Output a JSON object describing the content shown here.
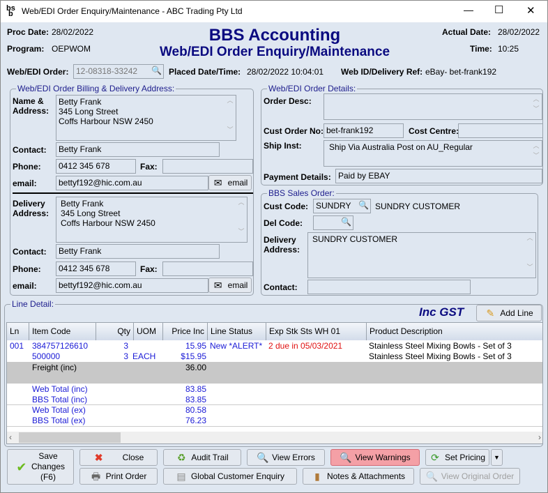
{
  "window": {
    "title": "Web/EDI Order Enquiry/Maintenance - ABC Trading Pty Ltd",
    "minimize": "—",
    "maximize": "☐",
    "close": "✕"
  },
  "header": {
    "proc_date_label": "Proc Date:",
    "proc_date": "28/02/2022",
    "program_label": "Program:",
    "program": "OEPWOM",
    "app_title": "BBS Accounting",
    "screen_title": "Web/EDI Order Enquiry/Maintenance",
    "actual_date_label": "Actual Date:",
    "actual_date": "28/02/2022",
    "time_label": "Time:",
    "time": "10:25"
  },
  "order": {
    "label": "Web/EDI Order:",
    "value": "12-08318-33242",
    "placed_label": "Placed Date/Time:",
    "placed": "28/02/2022 10:04:01",
    "webid_label": "Web ID/Delivery Ref:",
    "webid": "eBay- bet-frank192"
  },
  "billing": {
    "group_title": "Web/EDI Order Billing & Delivery Address:",
    "name_label": "Name &\nAddress:",
    "name_address": "Betty Frank\n345 Long Street\nCoffs Harbour NSW 2450",
    "contact_label": "Contact:",
    "contact": "Betty Frank",
    "phone_label": "Phone:",
    "phone": "0412 345 678",
    "fax_label": "Fax:",
    "fax": "",
    "email_label": "email:",
    "email": "bettyf192@hic.com.au",
    "email_button": "email"
  },
  "delivery": {
    "address_label": "Delivery\nAddress:",
    "address": "Betty Frank\n345 Long Street\nCoffs Harbour NSW 2450",
    "contact_label": "Contact:",
    "contact": "Betty Frank",
    "phone_label": "Phone:",
    "phone": "0412 345 678",
    "fax_label": "Fax:",
    "fax": "",
    "email_label": "email:",
    "email": "bettyf192@hic.com.au",
    "email_button": "email"
  },
  "details": {
    "group_title": "Web/EDI Order Details:",
    "desc_label": "Order Desc:",
    "desc": "",
    "cust_order_label": "Cust Order No:",
    "cust_order": "bet-frank192",
    "cost_centre_label": "Cost Centre:",
    "cost_centre": "",
    "ship_label": "Ship Inst:",
    "ship": "Ship Via Australia Post on AU_Regular",
    "payment_label": "Payment Details:",
    "payment": "Paid by EBAY"
  },
  "sales_order": {
    "group_title": "BBS Sales Order:",
    "cust_code_label": "Cust Code:",
    "cust_code": "SUNDRY",
    "cust_name": "SUNDRY CUSTOMER",
    "del_code_label": "Del Code:",
    "del_code": "",
    "del_addr_label": "Delivery\nAddress:",
    "del_addr": "SUNDRY CUSTOMER",
    "contact_label": "Contact:",
    "contact": ""
  },
  "lines": {
    "group_title": "Line Detail:",
    "inc_gst": "Inc GST",
    "add_line": "Add Line",
    "columns": [
      "Ln",
      "Item Code",
      "Qty",
      "UOM",
      "Price Inc",
      "Line Status",
      "Exp Stk Sts WH 01",
      "Product Description"
    ],
    "rows": [
      {
        "ln": "001",
        "item": "384757126610",
        "qty": "3",
        "uom": "",
        "price": "15.95",
        "status": "New *ALERT*",
        "stock": "2 due in 05/03/2021",
        "desc": "Stainless Steel Mixing Bowls - Set of 3"
      },
      {
        "ln": "",
        "item": "500000",
        "qty": "3",
        "uom": "EACH",
        "price": "$15.95",
        "status": "",
        "stock": "",
        "desc": "Stainless Steel Mixing Bowls - Set of 3"
      }
    ],
    "freight_label": "Freight (inc)",
    "freight": "36.00",
    "totals": [
      {
        "label": "Web Total (inc)",
        "value": "83.85"
      },
      {
        "label": "BBS Total (inc)",
        "value": "83.85"
      },
      {
        "label": "Web Total (ex)",
        "value": "80.58"
      },
      {
        "label": "BBS Total (ex)",
        "value": "76.23"
      }
    ]
  },
  "buttons": {
    "save": "Save\nChanges\n(F6)",
    "close": "Close",
    "audit": "Audit Trail",
    "errors": "View Errors",
    "warnings": "View Warnings",
    "pricing": "Set Pricing",
    "print": "Print Order",
    "global": "Global Customer Enquiry",
    "notes": "Notes & Attachments",
    "original": "View Original Order"
  },
  "colors": {
    "accent_title": "#0a0a80",
    "blue_text": "#1a1ad6",
    "alert_red": "#e01010",
    "warning_button": "#f4a0a6"
  }
}
